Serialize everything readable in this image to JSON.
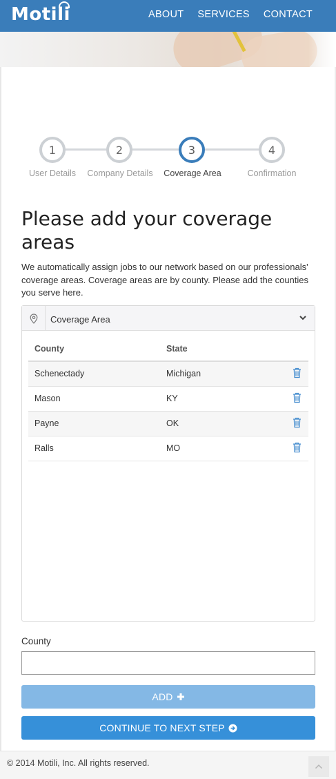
{
  "brand": {
    "name": "Motili"
  },
  "nav": {
    "items": [
      "ABOUT",
      "SERVICES",
      "CONTACT"
    ]
  },
  "steps": [
    {
      "number": "1",
      "label": "User Details",
      "active": false
    },
    {
      "number": "2",
      "label": "Company Details",
      "active": false
    },
    {
      "number": "3",
      "label": "Coverage Area",
      "active": true
    },
    {
      "number": "4",
      "label": "Confirmation",
      "active": false
    }
  ],
  "page": {
    "title": "Please add your coverage areas",
    "intro": "We automatically assign jobs to our network based on our professionals' coverage areas. Coverage areas are by county. Please add the counties you serve here."
  },
  "panel": {
    "title": "Coverage Area",
    "columns": {
      "county": "County",
      "state": "State"
    },
    "rows": [
      {
        "county": "Schenectady",
        "state": "Michigan"
      },
      {
        "county": "Mason",
        "state": "KY"
      },
      {
        "county": "Payne",
        "state": "OK"
      },
      {
        "county": "Ralls",
        "state": "MO"
      }
    ]
  },
  "form": {
    "county_label": "County",
    "county_value": "",
    "add_label": "ADD",
    "continue_label": "CONTINUE TO NEXT STEP"
  },
  "footer": {
    "copyright": "© 2014 Motili, Inc. All rights reserved."
  },
  "colors": {
    "brand_blue": "#3a7dba",
    "button_blue": "#3690d9",
    "button_light": "#84b8e5",
    "icon_blue": "#4a90d0"
  },
  "icons": [
    "map-pin-icon",
    "chevron-down-icon",
    "trash-icon",
    "plus-circle-icon",
    "arrow-circle-right-icon",
    "chevron-up-icon"
  ]
}
